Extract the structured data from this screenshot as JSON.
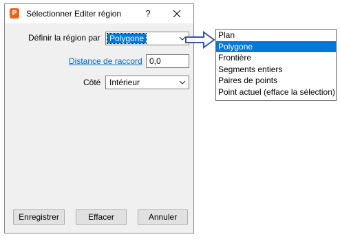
{
  "dialog": {
    "title": "Sélectionner Editer région",
    "icon_letter": "P",
    "help_label": "?",
    "close_icon": "close-icon"
  },
  "form": {
    "region_label": "Définir la région par",
    "region_value": "Polygone",
    "distance_label": "Distance de raccord",
    "distance_value": "0,0",
    "side_label": "Côté",
    "side_value": "Intérieur"
  },
  "buttons": {
    "save": "Enregistrer",
    "clear": "Effacer",
    "cancel": "Annuler"
  },
  "dropdown": {
    "options": [
      "Plan",
      "Polygone",
      "Frontière",
      "Segments entiers",
      "Paires de points",
      "Point actuel (efface la sélection)"
    ],
    "selected": "Polygone"
  },
  "colors": {
    "accent": "#0078d7",
    "link": "#0066cc",
    "arrow": "#3355aa",
    "app_icon": "#e8651a"
  }
}
